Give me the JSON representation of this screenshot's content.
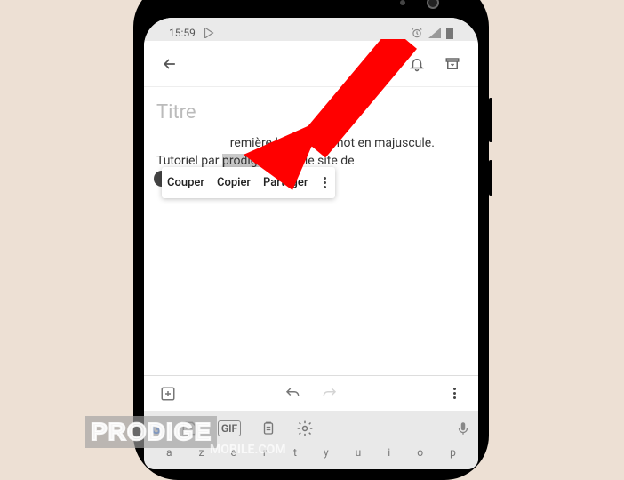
{
  "statusbar": {
    "time": "15:59"
  },
  "note": {
    "title_placeholder": "Titre",
    "body_leading": "remière lettre d'un mot en majuscule. Tutoriel par ",
    "body_selected": "prodigemobile",
    "body_trailing": " le site de"
  },
  "context_menu": {
    "cut": "Couper",
    "copy": "Copier",
    "share": "Partager"
  },
  "keyboard": {
    "gif_label": "GIF",
    "keys": [
      "a",
      "z",
      "e",
      "r",
      "t",
      "y",
      "u",
      "i",
      "o",
      "p"
    ]
  },
  "watermark": {
    "line1": "PRODIGE",
    "line2": "MOBILE.COM"
  }
}
